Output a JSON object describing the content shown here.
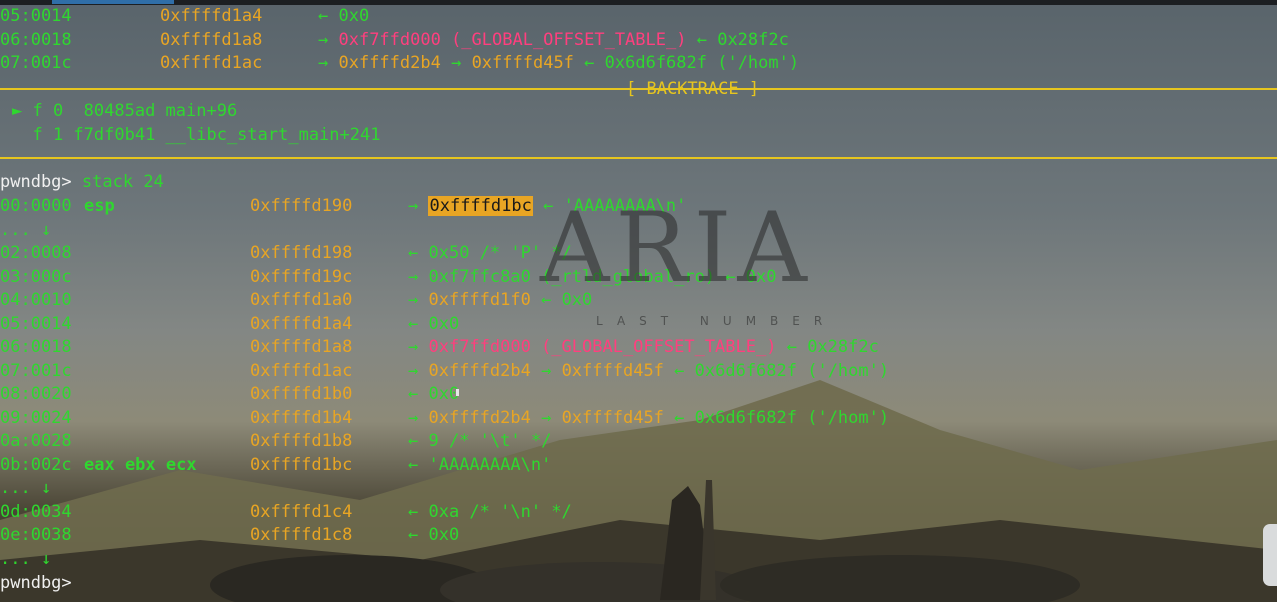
{
  "top": [
    {
      "idx": "05:0014",
      "addr": "0xffffd1a4",
      "rest": [
        [
          "arrow",
          "← "
        ],
        [
          "val",
          "0x0"
        ]
      ]
    },
    {
      "idx": "06:0018",
      "addr": "0xffffd1a8",
      "rest": [
        [
          "arrow",
          "→ "
        ],
        [
          "red",
          "0xf7ffd000 (_GLOBAL_OFFSET_TABLE_)"
        ],
        [
          "arrow",
          " ← "
        ],
        [
          "val",
          "0x28f2c"
        ]
      ]
    },
    {
      "idx": "07:001c",
      "addr": "0xffffd1ac",
      "rest": [
        [
          "arrow",
          "→ "
        ],
        [
          "addr",
          "0xffffd2b4"
        ],
        [
          "arrow",
          " → "
        ],
        [
          "addr",
          "0xffffd45f"
        ],
        [
          "arrow",
          " ← "
        ],
        [
          "val",
          "0x6d6f682f ('/hom')"
        ]
      ]
    }
  ],
  "backtrace_title": "[ BACKTRACE ]",
  "backtrace": [
    {
      "marker": "►",
      "text": "f 0  80485ad main+96"
    },
    {
      "marker": " ",
      "text": "f 1 f7df0b41 __libc_start_main+241"
    }
  ],
  "prompt": "pwndbg>",
  "command": "stack 24",
  "stack": [
    {
      "idx": "00:0000",
      "reg": "esp",
      "addr": "0xffffd190",
      "rest": [
        [
          "arrow",
          "→ "
        ],
        [
          "hl",
          "0xffffd1bc"
        ],
        [
          "arrow",
          " ← "
        ],
        [
          "val",
          "'AAAAAAAA\\n'"
        ]
      ]
    },
    {
      "idx": "... ↓",
      "reg": "",
      "addr": "",
      "rest": []
    },
    {
      "idx": "02:0008",
      "reg": "",
      "addr": "0xffffd198",
      "rest": [
        [
          "arrow",
          "← "
        ],
        [
          "val",
          "0x50 /* 'P' */"
        ]
      ]
    },
    {
      "idx": "03:000c",
      "reg": "",
      "addr": "0xffffd19c",
      "rest": [
        [
          "arrow",
          "→ "
        ],
        [
          "val",
          "0xf7ffc8a0 (_rtld_global_ro)"
        ],
        [
          "arrow",
          " ← "
        ],
        [
          "val",
          "0x0"
        ]
      ]
    },
    {
      "idx": "04:0010",
      "reg": "",
      "addr": "0xffffd1a0",
      "rest": [
        [
          "arrow",
          "→ "
        ],
        [
          "addr",
          "0xffffd1f0"
        ],
        [
          "arrow",
          " ← "
        ],
        [
          "val",
          "0x0"
        ]
      ]
    },
    {
      "idx": "05:0014",
      "reg": "",
      "addr": "0xffffd1a4",
      "rest": [
        [
          "arrow",
          "← "
        ],
        [
          "val",
          "0x0"
        ]
      ]
    },
    {
      "idx": "06:0018",
      "reg": "",
      "addr": "0xffffd1a8",
      "rest": [
        [
          "arrow",
          "→ "
        ],
        [
          "red",
          "0xf7ffd000 (_GLOBAL_OFFSET_TABLE_)"
        ],
        [
          "arrow",
          " ← "
        ],
        [
          "val",
          "0x28f2c"
        ]
      ]
    },
    {
      "idx": "07:001c",
      "reg": "",
      "addr": "0xffffd1ac",
      "rest": [
        [
          "arrow",
          "→ "
        ],
        [
          "addr",
          "0xffffd2b4"
        ],
        [
          "arrow",
          " → "
        ],
        [
          "addr",
          "0xffffd45f"
        ],
        [
          "arrow",
          " ← "
        ],
        [
          "val",
          "0x6d6f682f ('/hom')"
        ]
      ]
    },
    {
      "idx": "08:0020",
      "reg": "",
      "addr": "0xffffd1b0",
      "rest": [
        [
          "arrow",
          "← "
        ],
        [
          "val",
          "0x0"
        ]
      ]
    },
    {
      "idx": "09:0024",
      "reg": "",
      "addr": "0xffffd1b4",
      "rest": [
        [
          "arrow",
          "→ "
        ],
        [
          "addr",
          "0xffffd2b4"
        ],
        [
          "arrow",
          " → "
        ],
        [
          "addr",
          "0xffffd45f"
        ],
        [
          "arrow",
          " ← "
        ],
        [
          "val",
          "0x6d6f682f ('/hom')"
        ]
      ]
    },
    {
      "idx": "0a:0028",
      "reg": "",
      "addr": "0xffffd1b8",
      "rest": [
        [
          "arrow",
          "← "
        ],
        [
          "val",
          "9 /* '\\t' */"
        ]
      ]
    },
    {
      "idx": "0b:002c",
      "reg": "eax ebx ecx",
      "addr": "0xffffd1bc",
      "rest": [
        [
          "arrow",
          "← "
        ],
        [
          "val",
          "'AAAAAAAA\\n'"
        ]
      ]
    },
    {
      "idx": "... ↓",
      "reg": "",
      "addr": "",
      "rest": []
    },
    {
      "idx": "0d:0034",
      "reg": "",
      "addr": "0xffffd1c4",
      "rest": [
        [
          "arrow",
          "← "
        ],
        [
          "val",
          "0xa /* '\\n' */"
        ]
      ]
    },
    {
      "idx": "0e:0038",
      "reg": "",
      "addr": "0xffffd1c8",
      "rest": [
        [
          "arrow",
          "← "
        ],
        [
          "val",
          "0x0"
        ]
      ]
    },
    {
      "idx": "... ↓",
      "reg": "",
      "addr": "",
      "rest": []
    }
  ],
  "final_prompt": "pwndbg>",
  "watermark": {
    "title": "ARIA",
    "subtitle": "LAST NUMBER"
  }
}
